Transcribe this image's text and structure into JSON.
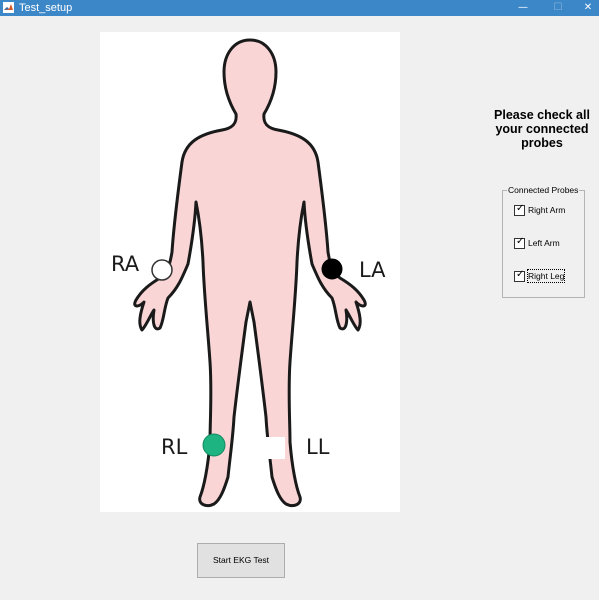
{
  "window": {
    "title": "Test_setup",
    "icon": "matlab-icon",
    "controls": {
      "minimize": "—",
      "maximize": "☐",
      "close": "✕"
    }
  },
  "figure": {
    "probes": [
      {
        "label": "RA",
        "color": "#ffffff"
      },
      {
        "label": "LA",
        "color": "#000000"
      },
      {
        "label": "RL",
        "color": "#1eb482"
      },
      {
        "label": "LL",
        "color": "#ffffff"
      }
    ],
    "body_color": "#f9d5d6"
  },
  "instruction": "Please check all your connected probes",
  "probes_panel": {
    "title": "Connected Probes",
    "options": [
      {
        "label": "Right Arm",
        "checked": true
      },
      {
        "label": "Left Arm",
        "checked": true
      },
      {
        "label": "Right Leg",
        "checked": true
      }
    ]
  },
  "actions": {
    "start_label": "Start EKG Test"
  }
}
